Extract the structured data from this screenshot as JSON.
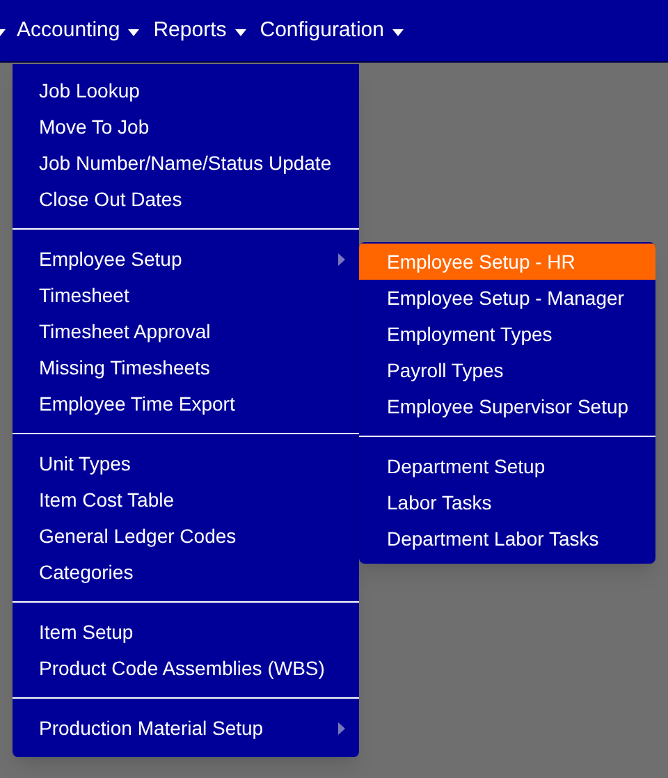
{
  "nav": [
    {
      "label": "Accounting"
    },
    {
      "label": "Reports"
    },
    {
      "label": "Configuration"
    }
  ],
  "menu": {
    "groups": [
      {
        "items": [
          {
            "label": "Job Lookup",
            "kind": "plain"
          },
          {
            "label": "Move To Job",
            "kind": "plain"
          },
          {
            "label": "Job Number/Name/Status Update",
            "kind": "plain"
          },
          {
            "label": "Close Out Dates",
            "kind": "plain"
          }
        ]
      },
      {
        "items": [
          {
            "label": "Employee Setup",
            "kind": "submenu"
          },
          {
            "label": "Timesheet",
            "kind": "plain"
          },
          {
            "label": "Timesheet Approval",
            "kind": "plain"
          },
          {
            "label": "Missing Timesheets",
            "kind": "plain"
          },
          {
            "label": "Employee Time Export",
            "kind": "plain"
          }
        ]
      },
      {
        "items": [
          {
            "label": "Unit Types",
            "kind": "plain"
          },
          {
            "label": "Item Cost Table",
            "kind": "plain"
          },
          {
            "label": "General Ledger Codes",
            "kind": "plain"
          },
          {
            "label": "Categories",
            "kind": "plain"
          }
        ]
      },
      {
        "items": [
          {
            "label": "Item Setup",
            "kind": "plain"
          },
          {
            "label": "Product Code Assemblies (WBS)",
            "kind": "plain"
          }
        ]
      },
      {
        "items": [
          {
            "label": "Production Material Setup",
            "kind": "submenu"
          }
        ]
      }
    ]
  },
  "submenu": {
    "groups": [
      {
        "items": [
          {
            "label": "Employee Setup - HR",
            "selected": true
          },
          {
            "label": "Employee Setup - Manager",
            "selected": false
          },
          {
            "label": "Employment Types",
            "selected": false
          },
          {
            "label": "Payroll Types",
            "selected": false
          },
          {
            "label": "Employee Supervisor Setup",
            "selected": false
          }
        ]
      },
      {
        "items": [
          {
            "label": "Department Setup",
            "selected": false
          },
          {
            "label": "Labor Tasks",
            "selected": false
          },
          {
            "label": "Department Labor Tasks",
            "selected": false
          }
        ]
      }
    ]
  }
}
